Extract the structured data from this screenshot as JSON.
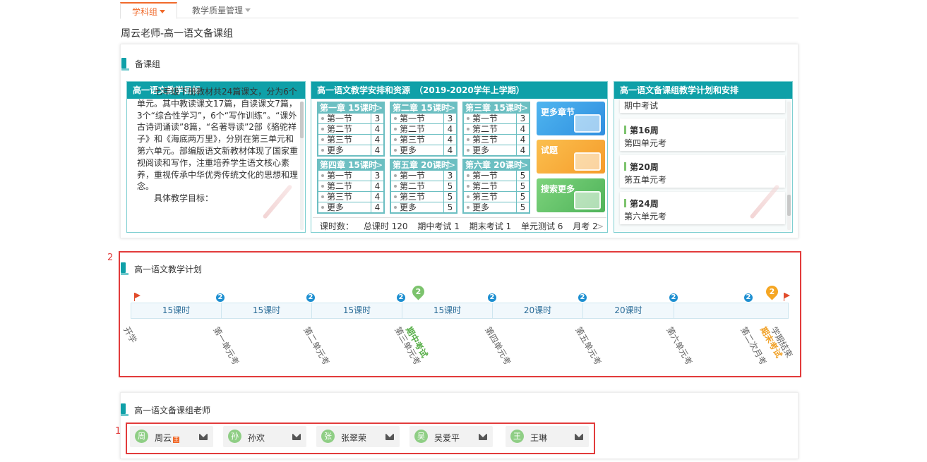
{
  "tabs": [
    {
      "label": "学科组",
      "active": true
    },
    {
      "label": "教学质量管理",
      "active": false
    }
  ],
  "page_title": "周云老师-高一语文备课组",
  "prep_group": {
    "section_title": "备课组",
    "goals": {
      "title": "高一语文教学目标",
      "text": "　　七年级下册教材共24篇课文，分为6个单元。其中教读课文17篇，自读课文7篇，3个“综合性学习”，6个“写作训练”。“课外古诗词诵读”8篇，“名著导读”2部《骆驼祥子》和《海底两万里》，分别在第三单元和第六单元。部编版语文新教材体现了国家重视阅读和写作，注重培养学生语文核心素养，重视传承中华优秀传统文化的思想和理念。",
      "text2": "　　具体教学目标："
    },
    "resources": {
      "title": "高一语文教学安排和资源　（2019-2020学年上学期）",
      "chapters": [
        {
          "title": "第一章 15课时",
          "rows": [
            {
              "name": "第一节",
              "num": "3"
            },
            {
              "name": "第二节",
              "num": "4"
            },
            {
              "name": "第三节",
              "num": "4"
            },
            {
              "name": "更多",
              "num": "4"
            }
          ]
        },
        {
          "title": "第二章 15课时",
          "rows": [
            {
              "name": "第一节",
              "num": "3"
            },
            {
              "name": "第二节",
              "num": "4"
            },
            {
              "name": "第三节",
              "num": "4"
            },
            {
              "name": "更多",
              "num": "4"
            }
          ]
        },
        {
          "title": "第三章 15课时",
          "rows": [
            {
              "name": "第一节",
              "num": "3"
            },
            {
              "name": "第二节",
              "num": "4"
            },
            {
              "name": "第三节",
              "num": "4"
            },
            {
              "name": "更多",
              "num": "4"
            }
          ]
        },
        {
          "title": "第四章 15课时",
          "rows": [
            {
              "name": "第一节",
              "num": "3"
            },
            {
              "name": "第二节",
              "num": "4"
            },
            {
              "name": "第三节",
              "num": "4"
            },
            {
              "name": "更多",
              "num": "4"
            }
          ]
        },
        {
          "title": "第五章 20课时",
          "rows": [
            {
              "name": "第一节",
              "num": "3"
            },
            {
              "name": "第二节",
              "num": "5"
            },
            {
              "name": "第三节",
              "num": "5"
            },
            {
              "name": "更多",
              "num": "5"
            }
          ]
        },
        {
          "title": "第六章 20课时",
          "rows": [
            {
              "name": "第一节",
              "num": "5"
            },
            {
              "name": "第二节",
              "num": "5"
            },
            {
              "name": "第三节",
              "num": "5"
            },
            {
              "name": "更多",
              "num": "5"
            }
          ]
        }
      ],
      "arrow": ">",
      "tiles": [
        "更多章节",
        "试题",
        "搜索更多"
      ],
      "stats": {
        "label": "课时数：",
        "items": [
          "总课时 120",
          "期中考试 1",
          "期末考试 1",
          "单元测试 6",
          "月考 2"
        ],
        "more": ">"
      }
    },
    "plan": {
      "title": "高一语文备课组教学计划和安排",
      "top_exam": "期中考试",
      "items": [
        {
          "week": "第16周",
          "exam": "第四单元考"
        },
        {
          "week": "第20周",
          "exam": "第五单元考"
        },
        {
          "week": "第24周",
          "exam": "第六单元考"
        }
      ]
    }
  },
  "teaching_plan": {
    "box_label": "2",
    "section_title": "高一语文教学计划",
    "segments": [
      "15课时",
      "15课时",
      "15课时",
      "15课时",
      "20课时",
      "20课时",
      ""
    ],
    "badge_text": "2",
    "pin_text": "2",
    "labels": [
      {
        "text": "开学",
        "style": "normal"
      },
      {
        "text": "第一单元考",
        "style": "normal"
      },
      {
        "text": "第二单元考",
        "style": "normal"
      },
      {
        "text": "第三单元考",
        "style": "normal"
      },
      {
        "text": "期中考试",
        "style": "green"
      },
      {
        "text": "第四单元考",
        "style": "normal"
      },
      {
        "text": "第五单元考",
        "style": "normal"
      },
      {
        "text": "第六单元考",
        "style": "normal"
      },
      {
        "text": "第二次月考",
        "style": "normal"
      },
      {
        "text": "期末考试",
        "style": "orange"
      },
      {
        "text": "学期结束",
        "style": "normal"
      }
    ]
  },
  "teachers": {
    "box_label": "1",
    "section_title": "高一语文备课组老师",
    "list": [
      {
        "avatar": "周",
        "name": "周云",
        "leader": true
      },
      {
        "avatar": "孙",
        "name": "孙欢",
        "leader": false
      },
      {
        "avatar": "张",
        "name": "张翠荣",
        "leader": false
      },
      {
        "avatar": "吴",
        "name": "吴爱平",
        "leader": false
      },
      {
        "avatar": "王",
        "name": "王琳",
        "leader": false
      }
    ],
    "leader_tag": "主"
  },
  "colors": {
    "accent": "#0fa0a8",
    "tab_active": "#f06a2b",
    "highlight_box": "#e23b3b",
    "badge": "#1d8fd1",
    "pin_green": "#7cc36d",
    "pin_orange": "#f5a623"
  },
  "icons": [
    "dropdown-caret-icon",
    "section-marker-icon",
    "chapter-arrow-icon",
    "flag-icon",
    "count-badge-icon",
    "map-pin-icon",
    "mail-icon",
    "leader-tag-icon"
  ]
}
